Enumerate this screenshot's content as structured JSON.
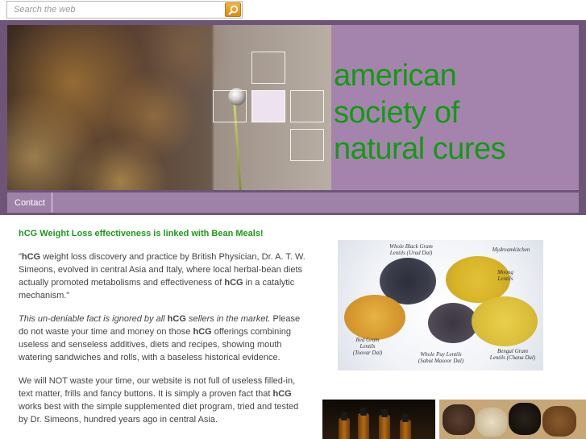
{
  "search": {
    "placeholder": "Search the web",
    "button_icon": "search-icon"
  },
  "header": {
    "title_lines": [
      "american",
      "society of",
      "natural cures"
    ],
    "title_color": "#129a12",
    "band_color": "#a484ad"
  },
  "nav": {
    "items": [
      {
        "label": "Contact"
      }
    ]
  },
  "article": {
    "headline": "hCG Weight Loss effectiveness is linked with Bean Meals!",
    "p1": {
      "open_quote": "\"",
      "b1": "hCG",
      "t1": " weight loss discovery and practice by British Physician, Dr. A. T. W. Simeons, evolved in central Asia and Italy, where local herbal-bean diets actually promoted metabolisms and effectiveness of ",
      "b2": "hCG",
      "t2": " in a catalytic mechanism.\""
    },
    "p2": {
      "i1": "This un-deniable fact is ignored by all ",
      "b1": "hCG",
      "i2": " sellers in the market.",
      "t1": " Please do not waste your time and money on those ",
      "b2": "hCG",
      "t2": " offerings combining useless and senseless additives, diets and recipes, showing mouth watering sandwiches and rolls, with a baseless historical evidence."
    },
    "p3": {
      "t1": "We will NOT waste your time, our website is not full of useless filled-in, text matter, frills and fancy buttons. It is simply a proven fact that ",
      "b1": "hCG",
      "t2": " works best with the simple supplemented diet program, tried and tested by Dr. Simeons, hundred years ago in central Asia."
    }
  },
  "beans_image": {
    "labels": {
      "black_gram": "Whole Black Gram\nLentils (Urad Dal)",
      "credit": "Mydreamkitchen",
      "moong": "Moong\nLentils",
      "red_gram": "Red Gram\nLentils\n(Toovar Dal)",
      "whole_puy": "Whole Puy Lentils\n(Sabut Masoor Dal)",
      "bengal_gram": "Bengal Gram\nLentils (Chana Dal)"
    }
  },
  "colors": {
    "accent_green": "#1c9a1c",
    "frame_purple": "#6e5577",
    "nav_purple": "#9f82a8",
    "search_orange": "#f0a020"
  }
}
